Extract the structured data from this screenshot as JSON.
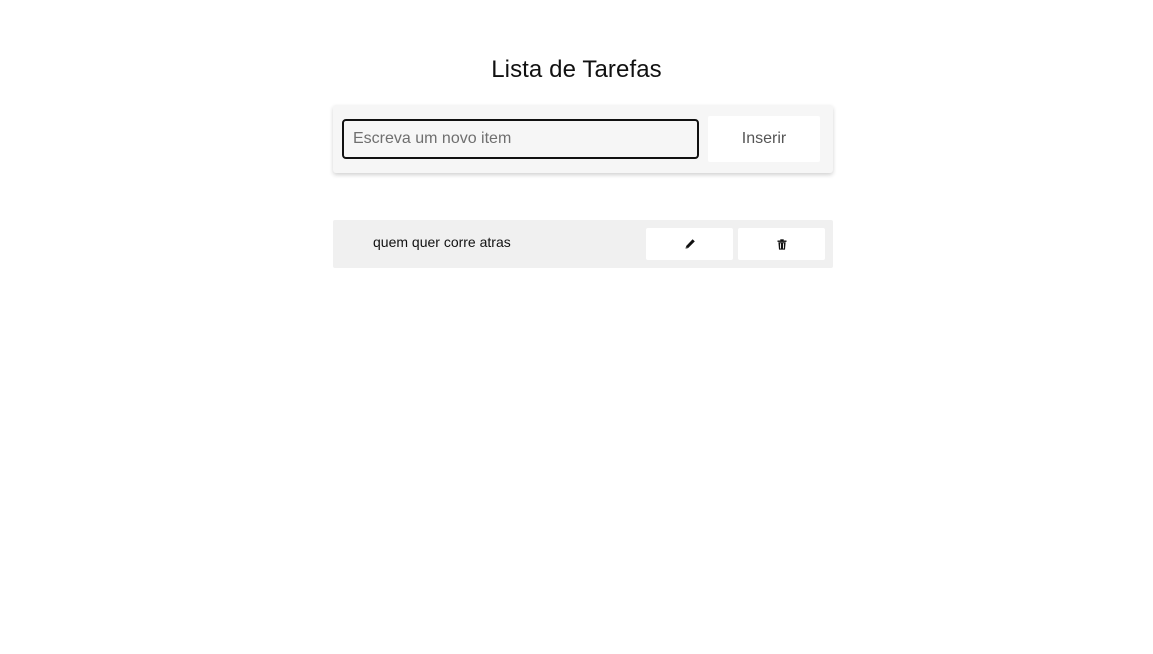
{
  "header": {
    "title": "Lista de Tarefas"
  },
  "new_item": {
    "placeholder": "Escreva um novo item",
    "value": "",
    "insert_label": "Inserir"
  },
  "tasks": [
    {
      "text": "quem quer corre atras",
      "edit_icon": "pencil-icon",
      "delete_icon": "trash-icon"
    }
  ]
}
